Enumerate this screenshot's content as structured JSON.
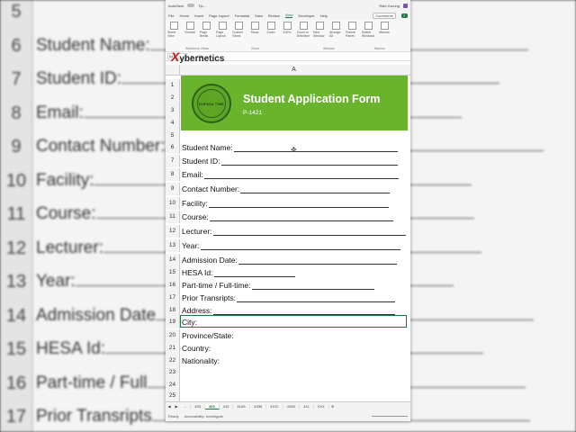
{
  "background": {
    "rows": [
      {
        "num": "5",
        "text": ""
      },
      {
        "num": "6",
        "text": "Student Name:"
      },
      {
        "num": "7",
        "text": "Student ID:"
      },
      {
        "num": "8",
        "text": "Email:"
      },
      {
        "num": "9",
        "text": "Contact Number:"
      },
      {
        "num": "10",
        "text": "Facility:"
      },
      {
        "num": "11",
        "text": "Course:"
      },
      {
        "num": "12",
        "text": "Lecturer:"
      },
      {
        "num": "13",
        "text": "Year:"
      },
      {
        "num": "14",
        "text": "Admission Date"
      },
      {
        "num": "15",
        "text": "HESA Id:"
      },
      {
        "num": "16",
        "text": "Part-time / Full"
      },
      {
        "num": "17",
        "text": "Prior Transripts"
      }
    ]
  },
  "titlebar": {
    "autosave": "AutoSave",
    "filename": "Tip...",
    "user": "Rabi Gurung"
  },
  "menu": {
    "items": [
      "File",
      "Home",
      "Insert",
      "Page Layout",
      "Formulas",
      "Data",
      "Review",
      "View",
      "Developer",
      "Help"
    ],
    "active": "View",
    "comments": "Comments"
  },
  "ribbon": {
    "buttons": [
      "Sheet View",
      "Normal",
      "Page Break",
      "Page Layout",
      "Custom Views",
      "Show",
      "Zoom",
      "100%",
      "Zoom to Selection",
      "New Window",
      "Arrange All",
      "Freeze Panes",
      "Switch Windows",
      "Macros"
    ],
    "groups": [
      "Workbook Views",
      "Zoom",
      "Window",
      "Macros"
    ]
  },
  "formula_bar": {
    "namebox": "A19",
    "fx": "fx",
    "content": "City"
  },
  "watermark": {
    "x": "X",
    "rest": "ybernetics"
  },
  "column_header": "A",
  "banner": {
    "seal_text": "RUPIGA TIME",
    "title": "Student Application Form",
    "code": "P-1421"
  },
  "row_numbers": [
    "1",
    "2",
    "3",
    "4",
    "5",
    "6",
    "7",
    "8",
    "9",
    "10",
    "11",
    "12",
    "13",
    "14",
    "15",
    "16",
    "17",
    "18",
    "19",
    "20",
    "21",
    "22",
    "23",
    "24",
    "25"
  ],
  "fields": [
    {
      "label": "Student Name:",
      "row": "6"
    },
    {
      "label": "Student ID:",
      "row": "7"
    },
    {
      "label": "Email:",
      "row": "8"
    },
    {
      "label": "Contact Number:",
      "row": "9"
    },
    {
      "label": "Facility:",
      "row": "10"
    },
    {
      "label": "Course:",
      "row": "11"
    },
    {
      "label": "Lecturer:",
      "row": "12"
    },
    {
      "label": "Year:",
      "row": "13"
    },
    {
      "label": "Admission Date:",
      "row": "14"
    },
    {
      "label": "HESA Id:",
      "row": "15"
    },
    {
      "label": "Part-time / Full-time:",
      "row": "16"
    },
    {
      "label": "Prior Transripts:",
      "row": "17"
    },
    {
      "label": "Address:",
      "row": "18"
    },
    {
      "label": "City:",
      "row": "19"
    },
    {
      "label": "Province/State:",
      "row": "20"
    },
    {
      "label": "Country:",
      "row": "21"
    },
    {
      "label": "Nationality:",
      "row": "22"
    }
  ],
  "sheet_tabs": {
    "items": [
      "...",
      "403",
      "409",
      "410",
      "410A",
      "410B",
      "410C",
      "410D",
      "411",
      "XXX"
    ],
    "active": "409"
  },
  "status": {
    "ready": "Ready",
    "accessibility": "Accessibility: Investigate"
  },
  "colors": {
    "banner_green": "#6ab42d",
    "excel_green": "#217346",
    "watermark_red": "#c0201b"
  }
}
